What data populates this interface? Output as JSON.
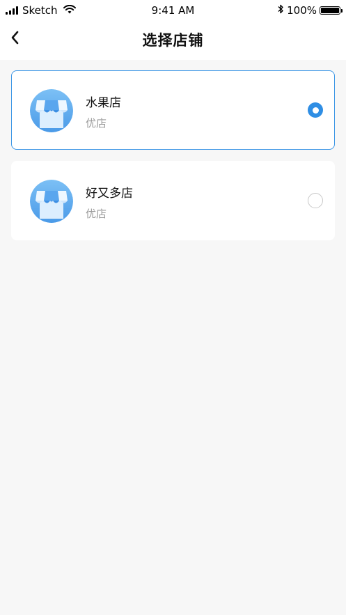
{
  "status_bar": {
    "carrier": "Sketch",
    "time": "9:41 AM",
    "battery": "100%",
    "signal_icon": "signal-bars-icon",
    "wifi_icon": "wifi-icon",
    "bluetooth_icon": "bluetooth-icon",
    "battery_icon": "battery-icon"
  },
  "nav": {
    "title": "选择店铺",
    "back_icon": "chevron-left-icon"
  },
  "stores": [
    {
      "name": "水果店",
      "type": "优店",
      "selected": true,
      "icon": "storefront-icon"
    },
    {
      "name": "好又多店",
      "type": "优店",
      "selected": false,
      "icon": "storefront-icon"
    }
  ],
  "colors": {
    "accent": "#2f8ee4",
    "selected_border": "#3d97e6",
    "background": "#f7f7f7",
    "card": "#ffffff",
    "secondary_text": "#9a9a9a"
  }
}
